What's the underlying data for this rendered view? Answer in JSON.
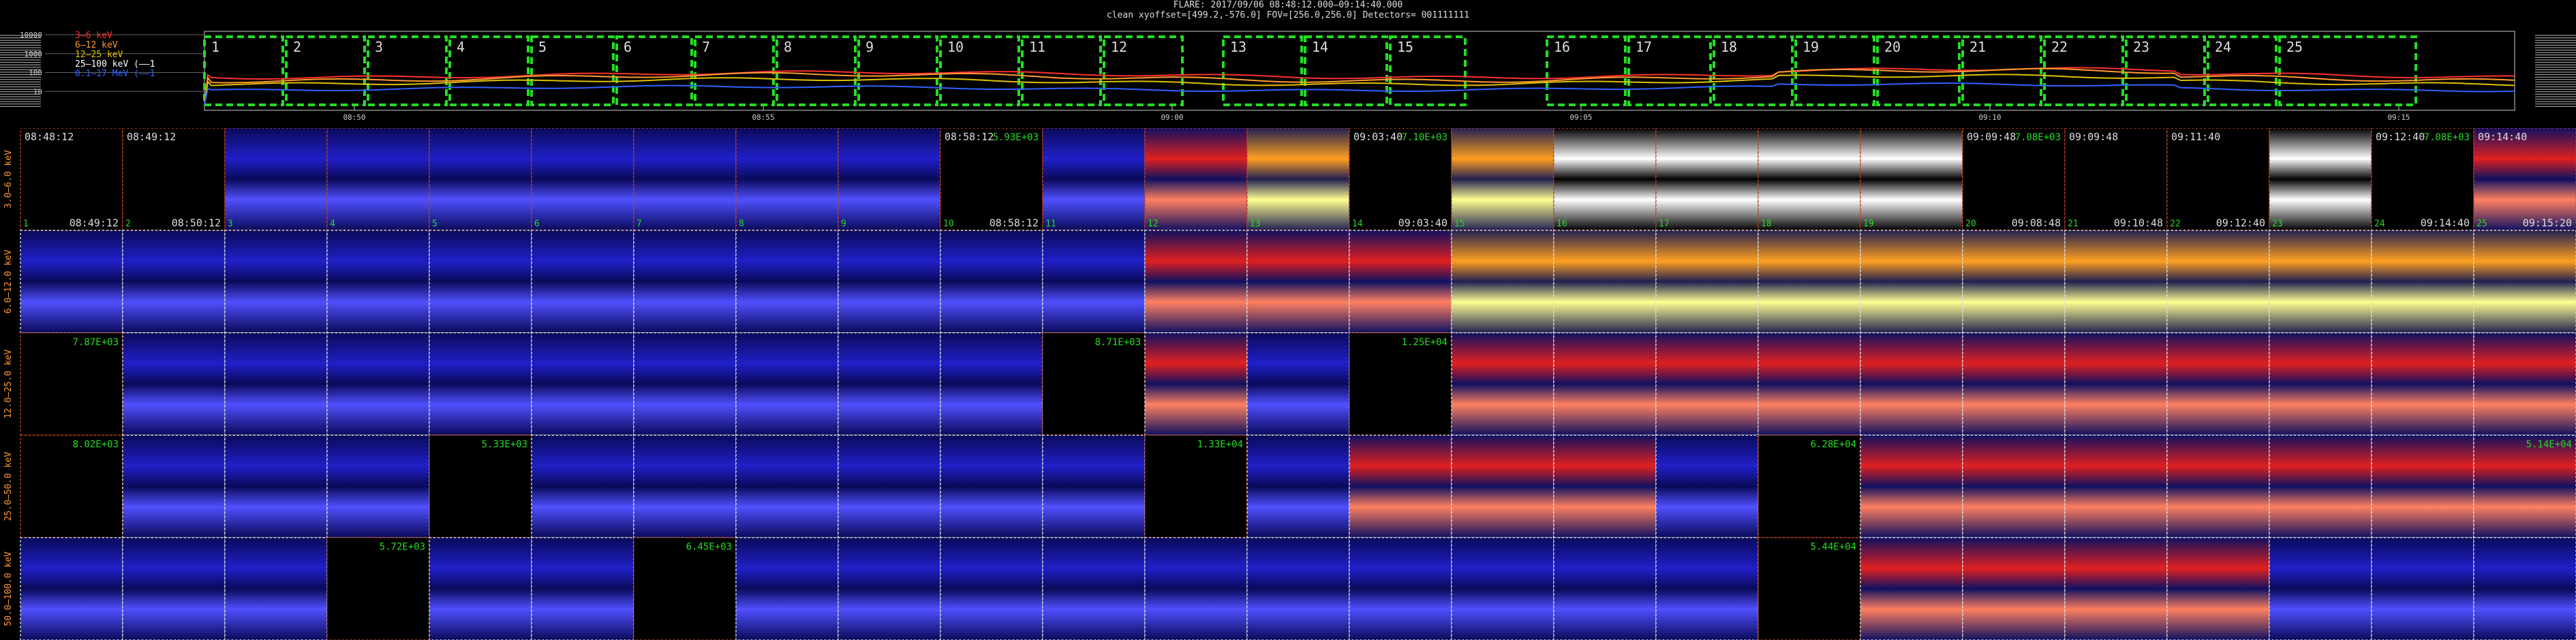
{
  "header": {
    "line1": "FLARE: 2017/09/06 08:48:12.000–09:14:40.000",
    "line2": "clean     xyoffset=[499.2,-576.0]     FOV=[256.0,256.0]     Detectors= 001111111"
  },
  "lightcurve": {
    "yticks": [
      "10000",
      "1000",
      "100",
      "10"
    ],
    "xticks": [
      "08:50",
      "08:55",
      "09:00",
      "09:05",
      "09:10",
      "09:15"
    ],
    "legend": [
      {
        "label": "3–6 keV",
        "color": "#ff3030"
      },
      {
        "label": "6–12 keV",
        "color": "#ff9a30"
      },
      {
        "label": "12–25 keV",
        "color": "#e0c000"
      },
      {
        "label": "25–100 keV (—–1",
        "color": "#ffffff"
      },
      {
        "label": "0.1–17 MeV (—–1",
        "color": "#3060ff"
      }
    ],
    "intervals": [
      "1",
      "2",
      "3",
      "4",
      "5",
      "6",
      "7",
      "8",
      "9",
      "10",
      "11",
      "12",
      "13",
      "14",
      "15",
      "16",
      "17",
      "18",
      "19",
      "20",
      "21",
      "22",
      "23",
      "24",
      "25"
    ]
  },
  "chart_data": {
    "type": "heatmap",
    "title": "FLARE: 2017/09/06 08:48:12.000–09:14:40.000",
    "ylabel_per_row": [
      "3.0–6.0 keV",
      "6.0–12.0 keV",
      "12.0–25.0 keV",
      "25.0–50.0 keV",
      "50.0–100.0 keV"
    ],
    "time_labels_top": [
      "08:48:12",
      "08:49:12",
      "",
      "",
      "",
      "",
      "",
      "",
      "",
      "08:58:12",
      "",
      "",
      "",
      "09:03:40",
      "",
      "",
      "",
      "",
      "",
      "09:09:48",
      "09:09:48",
      "09:11:40",
      "",
      "09:12:40",
      "09:14:40"
    ],
    "time_labels_bottom": [
      "08:49:12",
      "08:50:12",
      "",
      "",
      "",
      "",
      "",
      "",
      "",
      "08:58:12",
      "",
      "",
      "",
      "09:03:40",
      "",
      "",
      "",
      "",
      "",
      "09:08:48",
      "09:10:48",
      "09:12:40",
      "",
      "09:14:40",
      "09:15:20"
    ],
    "max_labels": {
      "0": {
        "9": "5.93E+03",
        "13": "7.10E+03",
        "19": "7.08E+03",
        "23": "7.08E+03"
      },
      "2": {
        "0": "7.87E+03",
        "10": "8.71E+03",
        "13": "1.25E+04"
      },
      "3": {
        "0": "8.02E+03",
        "4": "5.33E+03",
        "11": "1.33E+04",
        "17": "6.28E+04",
        "24": "5.14E+04"
      },
      "4": {
        "3": "5.72E+03",
        "6": "6.45E+03",
        "17": "5.44E+04"
      }
    },
    "blank_cells": [
      [
        0,
        0
      ],
      [
        0,
        1
      ],
      [
        0,
        9
      ],
      [
        0,
        13
      ],
      [
        0,
        19
      ],
      [
        0,
        20
      ],
      [
        0,
        21
      ],
      [
        0,
        23
      ],
      [
        2,
        0
      ],
      [
        2,
        10
      ],
      [
        2,
        13
      ],
      [
        3,
        0
      ],
      [
        3,
        4
      ],
      [
        3,
        11
      ],
      [
        3,
        17
      ],
      [
        4,
        3
      ],
      [
        4,
        6
      ],
      [
        4,
        17
      ]
    ],
    "cell_types": [
      [
        "e",
        "e",
        "b",
        "b",
        "b",
        "b",
        "b",
        "b",
        "b",
        "e",
        "b",
        "r",
        "y",
        "e",
        "y",
        "w",
        "w",
        "w",
        "w",
        "e",
        "e",
        "e",
        "w",
        "e",
        "r"
      ],
      [
        "b",
        "b",
        "b",
        "b",
        "b",
        "b",
        "b",
        "b",
        "b",
        "b",
        "b",
        "r",
        "r",
        "r",
        "y",
        "y",
        "y",
        "y",
        "y",
        "y",
        "y",
        "y",
        "y",
        "y",
        "y"
      ],
      [
        "e",
        "b",
        "b",
        "b",
        "b",
        "b",
        "b",
        "b",
        "b",
        "b",
        "e",
        "r",
        "b",
        "e",
        "r",
        "r",
        "r",
        "r",
        "r",
        "r",
        "r",
        "r",
        "r",
        "r",
        "r"
      ],
      [
        "e",
        "b",
        "b",
        "b",
        "e",
        "b",
        "b",
        "b",
        "b",
        "b",
        "b",
        "e",
        "b",
        "r",
        "r",
        "r",
        "b",
        "e",
        "r",
        "r",
        "r",
        "r",
        "r",
        "r",
        "r"
      ],
      [
        "b",
        "b",
        "b",
        "e",
        "b",
        "b",
        "e",
        "b",
        "b",
        "b",
        "b",
        "b",
        "b",
        "b",
        "b",
        "b",
        "b",
        "e",
        "r",
        "r",
        "r",
        "r",
        "b",
        "b",
        "b"
      ]
    ]
  }
}
